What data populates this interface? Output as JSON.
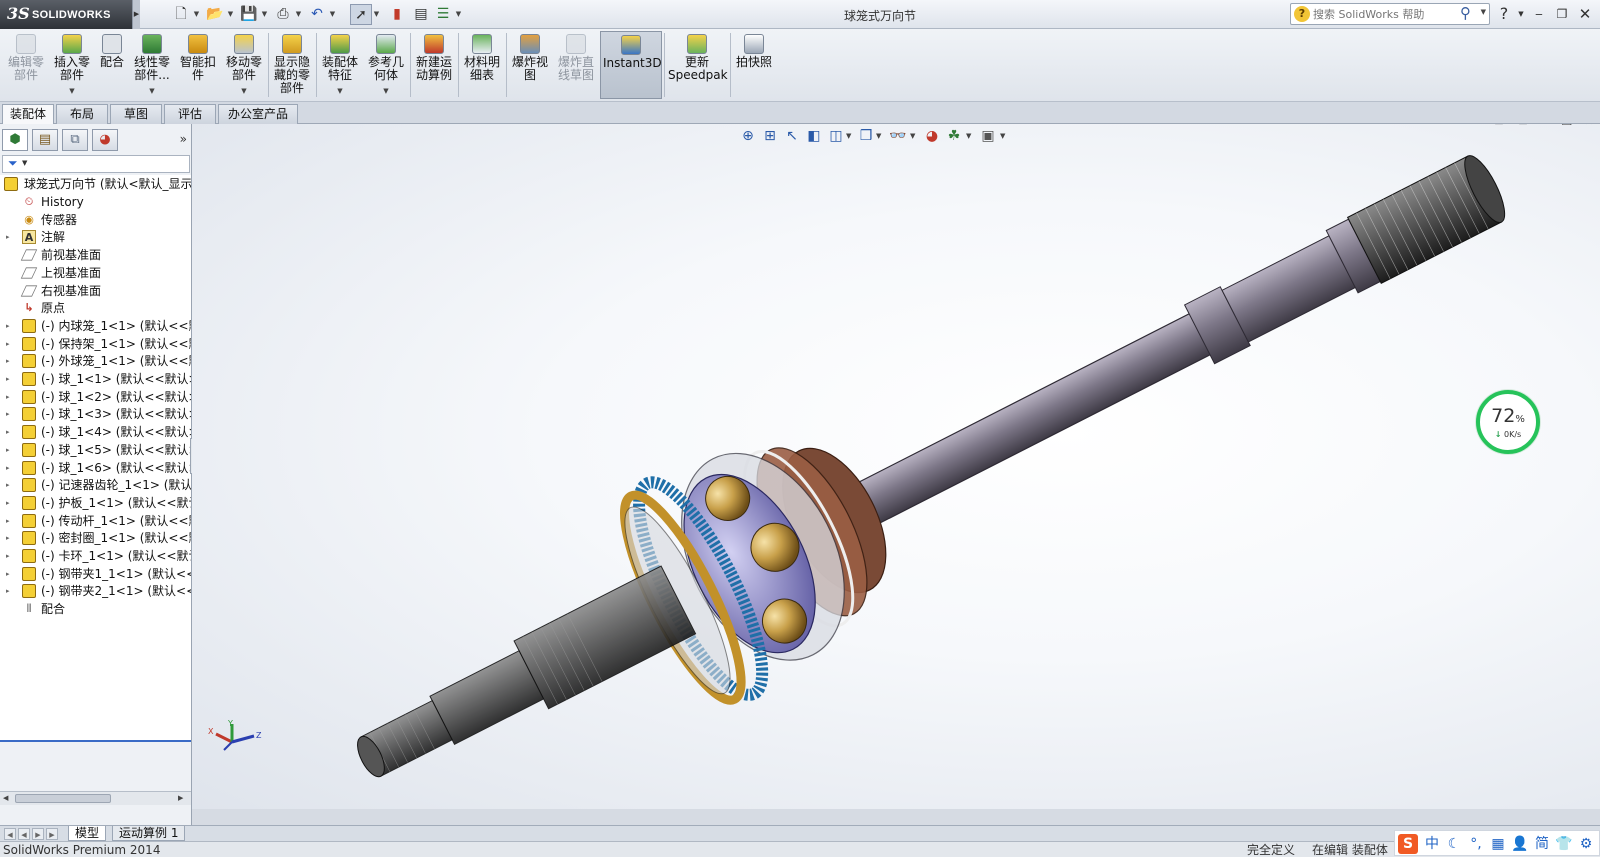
{
  "app": {
    "brand_mark": "3S",
    "brand": "SOLIDWORKS",
    "title": "球笼式万向节"
  },
  "quick_access": {
    "icons": [
      "new-icon",
      "open-icon",
      "save-icon",
      "print-icon",
      "undo-icon",
      "select-icon",
      "rebuild-icon",
      "file-properties-icon",
      "options-icon"
    ]
  },
  "help": {
    "search_placeholder": "搜索 SolidWorks 帮助"
  },
  "ribbon": {
    "buttons": [
      {
        "label": "编辑零部件",
        "icon": "edit-component-icon",
        "disabled": true
      },
      {
        "label": "插入零部件",
        "icon": "insert-component-icon",
        "disabled": false
      },
      {
        "label": "配合",
        "icon": "mate-icon",
        "disabled": false
      },
      {
        "label": "线性零部件...",
        "icon": "linear-pattern-icon",
        "disabled": false
      },
      {
        "label": "智能扣件",
        "icon": "smart-fasteners-icon",
        "disabled": false
      },
      {
        "label": "移动零部件",
        "icon": "move-component-icon",
        "disabled": false
      },
      {
        "label": "显示隐藏的零部件",
        "icon": "show-hidden-icon",
        "disabled": false
      },
      {
        "label": "装配体特征",
        "icon": "assembly-features-icon",
        "disabled": false
      },
      {
        "label": "参考几何体",
        "icon": "reference-geometry-icon",
        "disabled": false
      },
      {
        "label": "新建运动算例",
        "icon": "motion-study-icon",
        "disabled": false
      },
      {
        "label": "材料明细表",
        "icon": "bom-icon",
        "disabled": false
      },
      {
        "label": "爆炸视图",
        "icon": "exploded-view-icon",
        "disabled": false
      },
      {
        "label": "爆炸直线草图",
        "icon": "explode-line-sketch-icon",
        "disabled": true
      },
      {
        "label": "Instant3D",
        "icon": "instant3d-icon",
        "disabled": false,
        "active": true
      },
      {
        "label": "更新Speedpak",
        "icon": "speedpak-icon",
        "disabled": false
      },
      {
        "label": "拍快照",
        "icon": "snapshot-icon",
        "disabled": false
      }
    ]
  },
  "command_tabs": [
    "装配体",
    "布局",
    "草图",
    "评估",
    "办公室产品"
  ],
  "feature_tree": {
    "root": "球笼式万向节  (默认<默认_显示",
    "items": [
      {
        "label": "History",
        "icon": "history-icon",
        "expandable": false
      },
      {
        "label": "传感器",
        "icon": "sensor-icon",
        "expandable": false
      },
      {
        "label": "注解",
        "icon": "annotation-icon",
        "expandable": true
      },
      {
        "label": "前视基准面",
        "icon": "plane-icon",
        "expandable": false
      },
      {
        "label": "上视基准面",
        "icon": "plane-icon",
        "expandable": false
      },
      {
        "label": "右视基准面",
        "icon": "plane-icon",
        "expandable": false
      },
      {
        "label": "原点",
        "icon": "origin-icon",
        "expandable": false
      },
      {
        "label": "(-) 内球笼_1<1> (默认<<默",
        "icon": "part-icon",
        "expandable": true
      },
      {
        "label": "(-) 保持架_1<1> (默认<<默",
        "icon": "part-icon",
        "expandable": true
      },
      {
        "label": "(-) 外球笼_1<1> (默认<<默",
        "icon": "part-icon",
        "expandable": true
      },
      {
        "label": "(-) 球_1<1> (默认<<默认>_",
        "icon": "part-icon",
        "expandable": true
      },
      {
        "label": "(-) 球_1<2> (默认<<默认>_",
        "icon": "part-icon",
        "expandable": true
      },
      {
        "label": "(-) 球_1<3> (默认<<默认>_",
        "icon": "part-icon",
        "expandable": true
      },
      {
        "label": "(-) 球_1<4> (默认<<默认>_",
        "icon": "part-icon",
        "expandable": true
      },
      {
        "label": "(-) 球_1<5> (默认<<默认>_",
        "icon": "part-icon",
        "expandable": true
      },
      {
        "label": "(-) 球_1<6> (默认<<默认>_",
        "icon": "part-icon",
        "expandable": true
      },
      {
        "label": "(-) 记速器齿轮_1<1> (默认<",
        "icon": "part-icon",
        "expandable": true
      },
      {
        "label": "(-) 护板_1<1> (默认<<默认",
        "icon": "part-icon",
        "expandable": true
      },
      {
        "label": "(-) 传动杆_1<1> (默认<<默",
        "icon": "part-icon",
        "expandable": true
      },
      {
        "label": "(-) 密封圈_1<1> (默认<<默",
        "icon": "part-icon",
        "expandable": true
      },
      {
        "label": "(-) 卡环_1<1> (默认<<默认",
        "icon": "part-icon",
        "expandable": true
      },
      {
        "label": "(-) 钢带夹1_1<1> (默认<<默",
        "icon": "part-icon",
        "expandable": true
      },
      {
        "label": "(-) 钢带夹2_1<1> (默认<<默",
        "icon": "part-icon",
        "expandable": true
      },
      {
        "label": "配合",
        "icon": "mates-folder-icon",
        "expandable": false
      }
    ]
  },
  "model_tabs": [
    "模型",
    "运动算例 1"
  ],
  "status": {
    "product": "SolidWorks Premium 2014",
    "definition": "完全定义",
    "mode": "在编辑 装配体"
  },
  "speed_widget": {
    "percent": "72",
    "percent_unit": "%",
    "rate": "0K/s",
    "arrow": "↓"
  },
  "triad": {
    "x": "X",
    "y": "Y",
    "z": "Z"
  },
  "ime": {
    "logo": "S",
    "items": [
      "中",
      "☾",
      "°,",
      "▦",
      "👤",
      "简",
      "👕",
      "⚙"
    ]
  },
  "colors": {
    "accent": "#3a6bc6",
    "speed_ring": "#26c35a"
  }
}
